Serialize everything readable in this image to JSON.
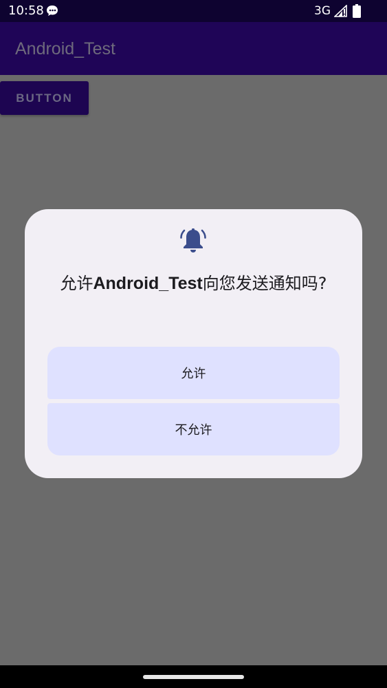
{
  "status_bar": {
    "time": "10:58",
    "network": "3G",
    "notification_icon": "chat-bubble-icon",
    "signal_icon": "cell-signal-icon",
    "battery_icon": "battery-icon"
  },
  "app_bar": {
    "title": "Android_Test"
  },
  "main": {
    "button_label": "BUTTON"
  },
  "dialog": {
    "icon": "bell-icon",
    "title_prefix": "允许",
    "title_app": "Android_Test",
    "title_suffix": "向您发送通知吗?",
    "allow_label": "允许",
    "deny_label": "不允许"
  },
  "colors": {
    "status_bar_bg": "#0e0330",
    "app_bar_bg": "#1f0557",
    "scrim": "#6b6b6b",
    "dialog_bg": "#f2eff5",
    "dialog_button_bg": "#dfe1ff",
    "bell_icon": "#3b4d8c"
  }
}
